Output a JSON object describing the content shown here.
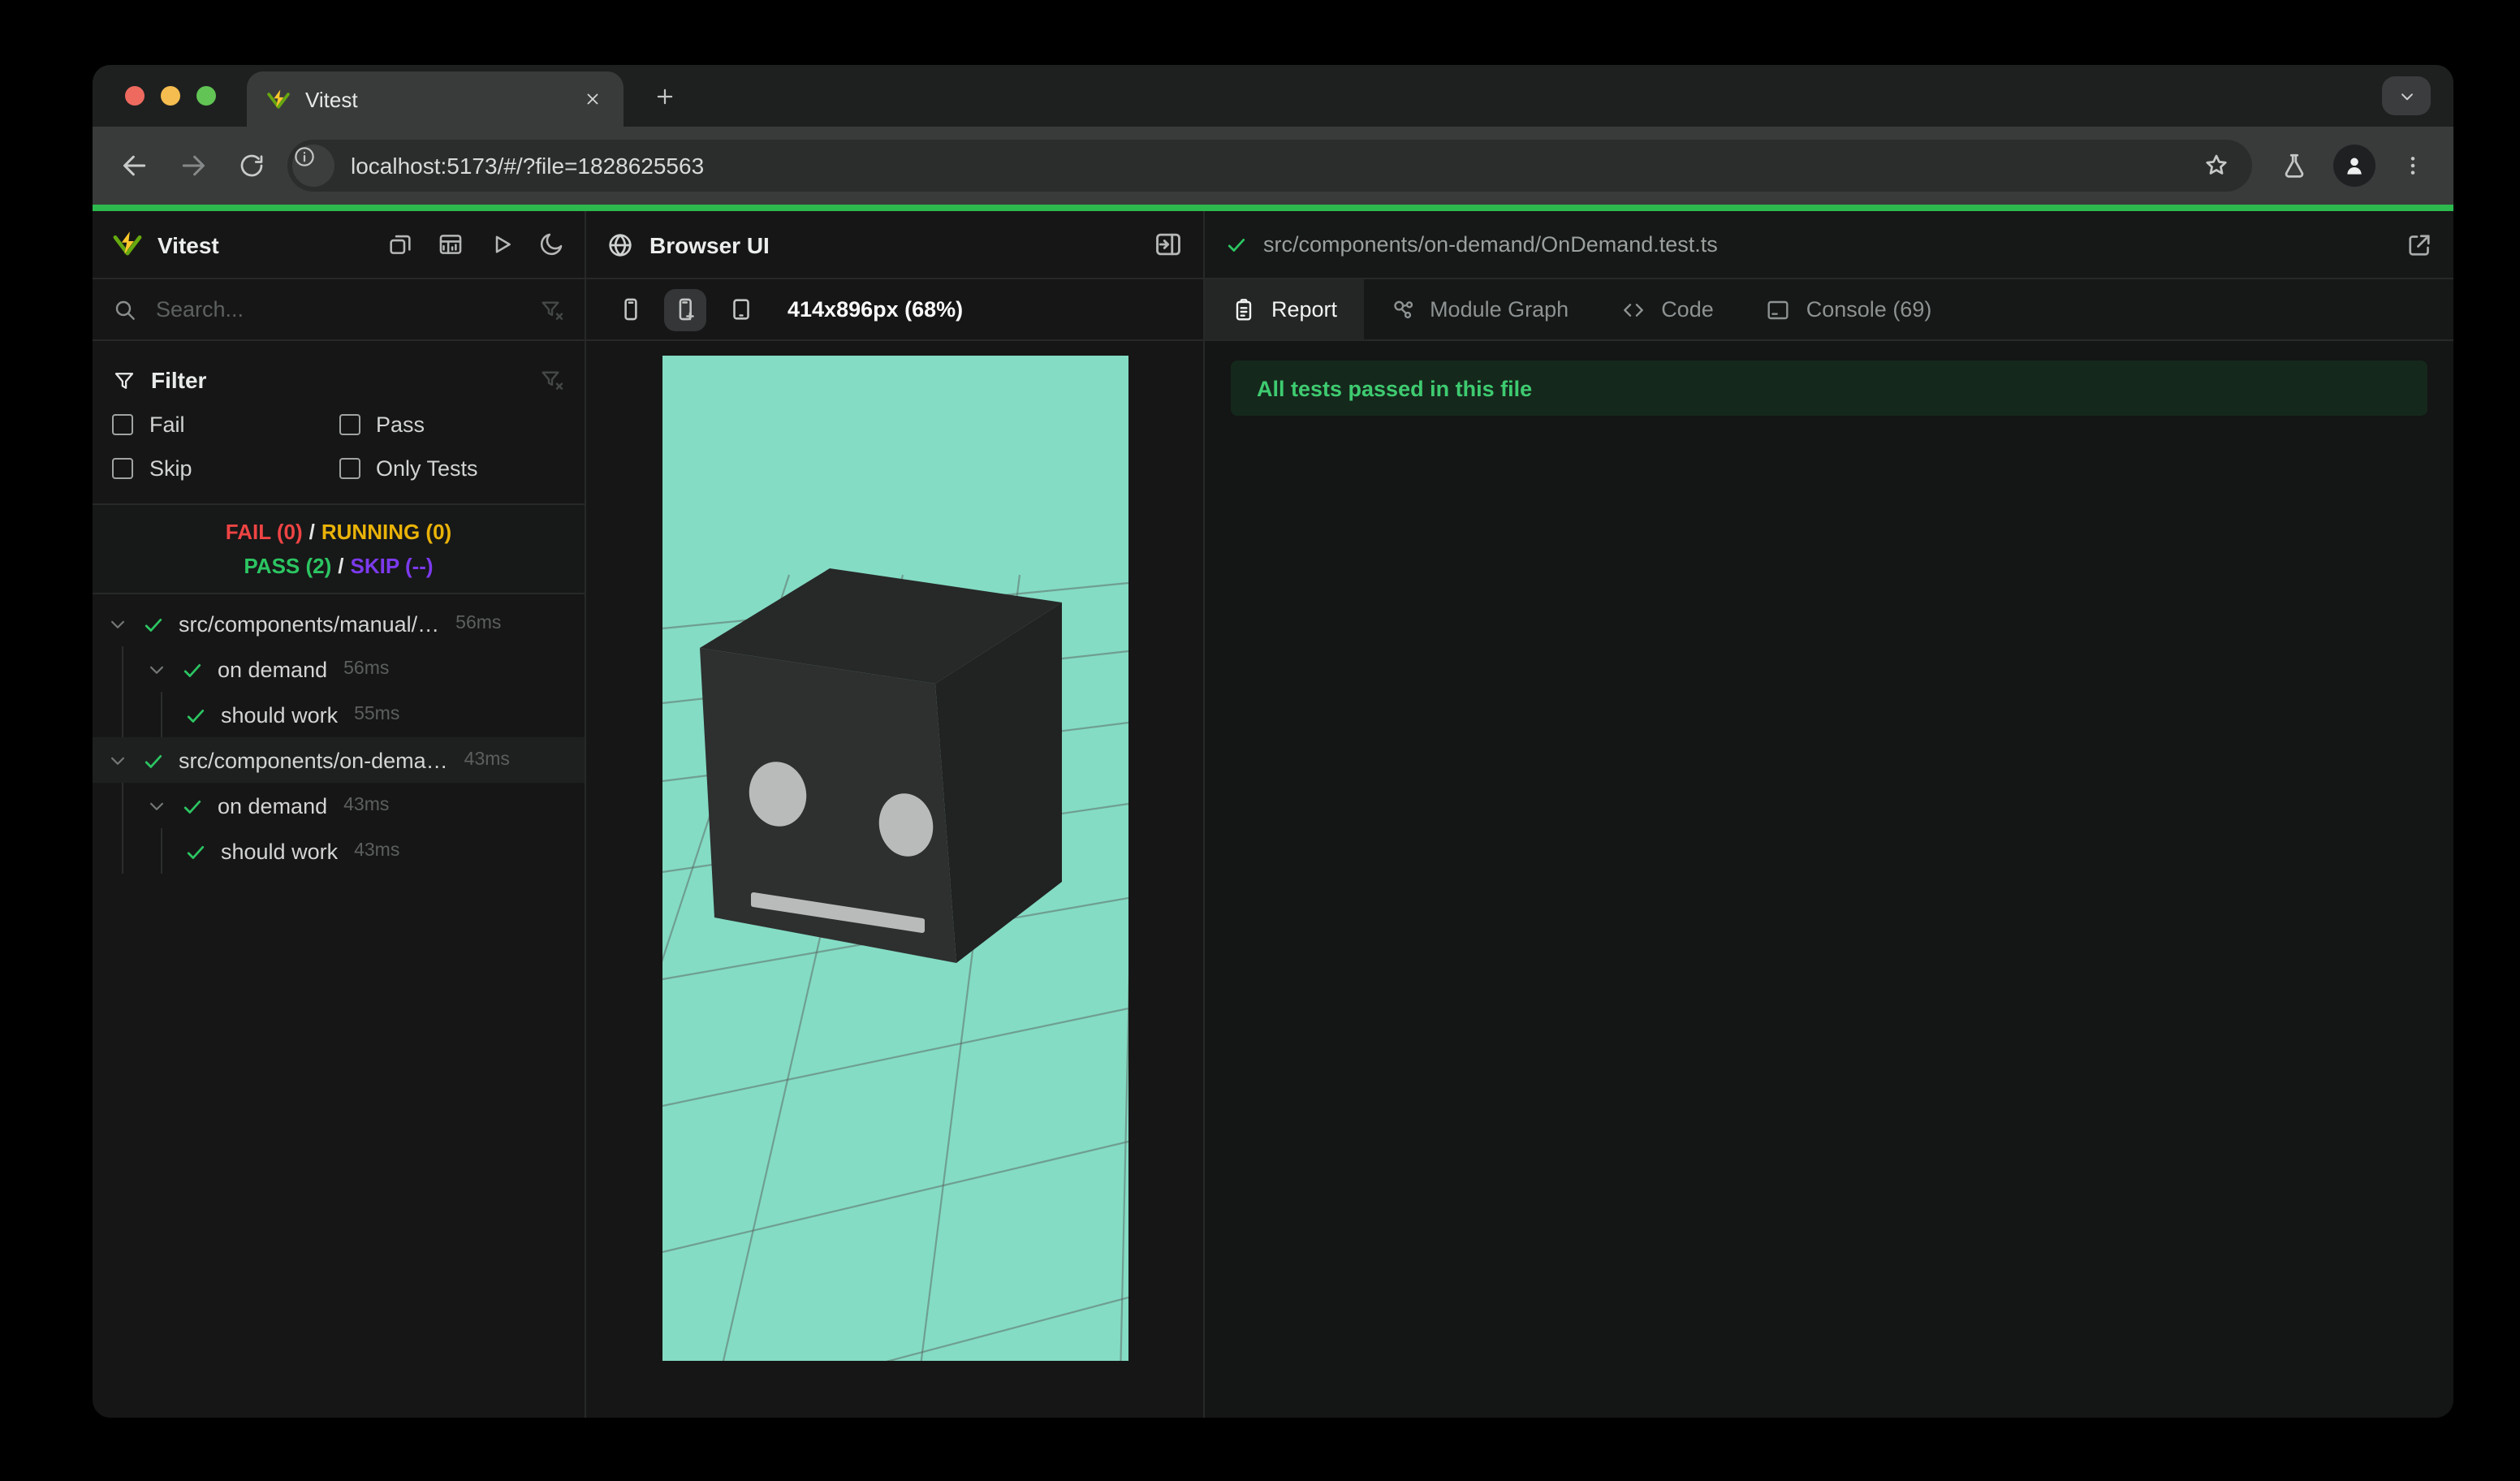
{
  "browser_chrome": {
    "tab_title": "Vitest",
    "url": "localhost:5173/#/?file=1828625563"
  },
  "colors": {
    "accent_green": "#2eb94e",
    "pass": "#2cc562",
    "fail": "#ef4444",
    "running": "#eab308",
    "skip": "#7c3aed",
    "viewport_bg": "#84dcc4",
    "grid_line": "#5a615d",
    "cube_front": "#2e2f2f",
    "cube_top": "#272828",
    "cube_side": "#212222",
    "cube_face_features": "#b9baba",
    "banner_bg": "#15281c",
    "banner_text": "#3ecb70",
    "vitest_logo_green": "#66a80f",
    "vitest_logo_yellow": "#fcc72b",
    "mac_close": "#ee6a5f",
    "mac_minimize": "#f5bd4f",
    "mac_zoom": "#61c454"
  },
  "sidebar": {
    "app_title": "Vitest",
    "header_icons": [
      "restore-windows-icon",
      "dashboard-icon",
      "run-all-icon",
      "moon-icon"
    ],
    "search_placeholder": "Search...",
    "filter": {
      "title": "Filter",
      "options": [
        "Fail",
        "Pass",
        "Skip",
        "Only Tests"
      ]
    },
    "summary": {
      "fail": "FAIL (0)",
      "running": "RUNNING (0)",
      "pass": "PASS (2)",
      "skip": "SKIP (--)",
      "separator": "/"
    },
    "tree": [
      {
        "label": "src/components/manual/…",
        "time": "56ms",
        "level": 0,
        "expandable": true,
        "selected": false,
        "status": "pass"
      },
      {
        "label": "on demand",
        "time": "56ms",
        "level": 1,
        "expandable": true,
        "selected": false,
        "status": "pass"
      },
      {
        "label": "should work",
        "time": "55ms",
        "level": 2,
        "expandable": false,
        "selected": false,
        "status": "pass"
      },
      {
        "label": "src/components/on-dema…",
        "time": "43ms",
        "level": 0,
        "expandable": true,
        "selected": true,
        "status": "pass"
      },
      {
        "label": "on demand",
        "time": "43ms",
        "level": 1,
        "expandable": true,
        "selected": false,
        "status": "pass"
      },
      {
        "label": "should work",
        "time": "43ms",
        "level": 2,
        "expandable": false,
        "selected": false,
        "status": "pass"
      }
    ]
  },
  "browser_panel": {
    "title": "Browser UI",
    "viewport_label": "414x896px (68%)",
    "devices": [
      {
        "icon": "smartphone-icon",
        "active": false
      },
      {
        "icon": "smartphone-add-icon",
        "active": true
      },
      {
        "icon": "tablet-icon",
        "active": false
      }
    ]
  },
  "report_panel": {
    "file_path": "src/components/on-demand/OnDemand.test.ts",
    "file_status": "pass",
    "tabs": [
      {
        "label": "Report",
        "icon": "clipboard-icon",
        "active": true
      },
      {
        "label": "Module Graph",
        "icon": "module-graph-icon",
        "active": false
      },
      {
        "label": "Code",
        "icon": "code-icon",
        "active": false
      },
      {
        "label": "Console (69)",
        "icon": "console-icon",
        "active": false
      }
    ],
    "banner": "All tests passed in this file"
  }
}
